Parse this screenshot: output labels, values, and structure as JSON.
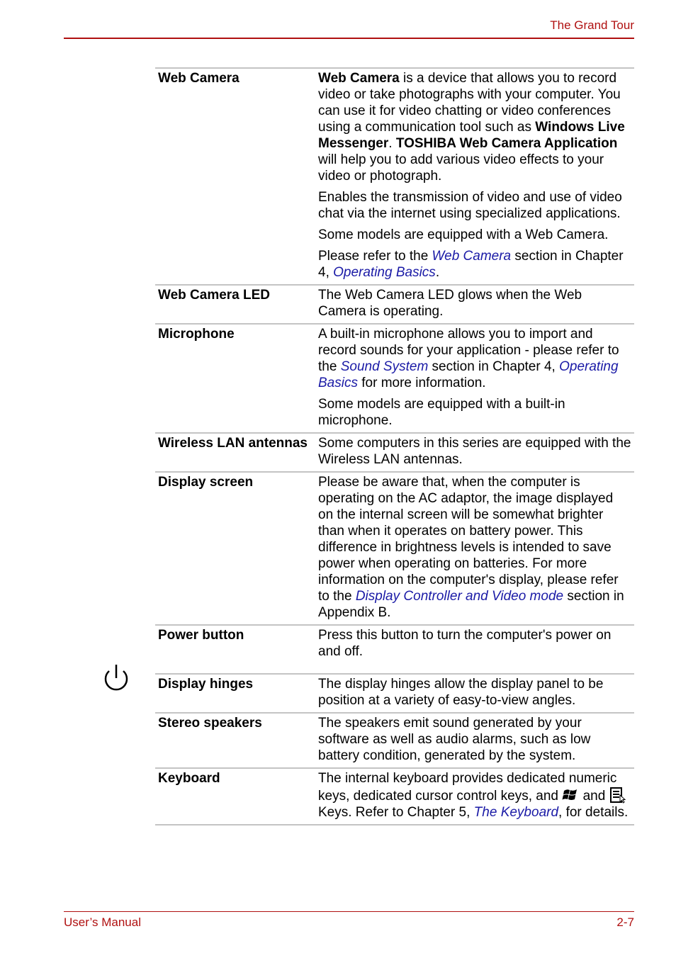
{
  "header": {
    "title": "The Grand Tour",
    "accent_color": "#b01010"
  },
  "footer": {
    "left": "User’s Manual",
    "right": "2-7"
  },
  "link_color": "#1a1aa6",
  "rows": [
    {
      "term": "Web Camera",
      "paragraphs": [
        {
          "segments": [
            {
              "t": "Web Camera",
              "s": "bold"
            },
            {
              "t": " is a device that allows you to record video or take photographs with your computer. You can use it for video chatting or video conferences using a communication tool such as "
            },
            {
              "t": "Windows Live Messenger",
              "s": "bold"
            },
            {
              "t": ". "
            },
            {
              "t": "TOSHIBA Web Camera Application",
              "s": "bold"
            },
            {
              "t": " will help you to add various video effects to your video or photograph."
            }
          ]
        },
        {
          "segments": [
            {
              "t": "Enables the transmission of video and use of video chat via the internet using specialized applications."
            }
          ]
        },
        {
          "segments": [
            {
              "t": "Some models are equipped with a Web Camera."
            }
          ]
        },
        {
          "segments": [
            {
              "t": "Please refer to the "
            },
            {
              "t": "Web Camera",
              "s": "link"
            },
            {
              "t": " section in Chapter 4, "
            },
            {
              "t": "Operating Basics",
              "s": "link"
            },
            {
              "t": "."
            }
          ]
        }
      ]
    },
    {
      "term": "Web Camera LED",
      "paragraphs": [
        {
          "segments": [
            {
              "t": "The Web Camera LED glows when the Web Camera is operating."
            }
          ]
        }
      ]
    },
    {
      "term": "Microphone",
      "paragraphs": [
        {
          "segments": [
            {
              "t": "A built-in microphone allows you to import and record sounds for your application - please refer to the "
            },
            {
              "t": "Sound System",
              "s": "link"
            },
            {
              "t": " section in Chapter 4, "
            },
            {
              "t": "Operating Basics",
              "s": "link"
            },
            {
              "t": " for more information."
            }
          ]
        },
        {
          "segments": [
            {
              "t": "Some models are equipped with a built-in microphone."
            }
          ]
        }
      ]
    },
    {
      "term": "Wireless LAN antennas",
      "paragraphs": [
        {
          "segments": [
            {
              "t": "Some computers in this series are equipped with the Wireless LAN antennas."
            }
          ]
        }
      ]
    },
    {
      "term": "Display screen",
      "paragraphs": [
        {
          "segments": [
            {
              "t": "Please be aware that, when the computer is operating on the AC adaptor, the image displayed on the internal screen will be somewhat brighter than when it operates on battery power. This difference in brightness levels is intended to save power when operating on batteries. For more information on the computer's display, please refer to the "
            },
            {
              "t": "Display Controller and Video mode",
              "s": "link"
            },
            {
              "t": " section in Appendix B."
            }
          ]
        }
      ]
    },
    {
      "term": "Power button",
      "icon": "power-icon",
      "paragraphs": [
        {
          "segments": [
            {
              "t": "Press this button to turn the computer's power on and off."
            }
          ]
        }
      ]
    },
    {
      "term": "Display hinges",
      "paragraphs": [
        {
          "segments": [
            {
              "t": "The display hinges allow the display panel to be position at a variety of easy-to-view angles."
            }
          ]
        }
      ]
    },
    {
      "term": "Stereo speakers",
      "paragraphs": [
        {
          "segments": [
            {
              "t": "The speakers emit sound generated by your software as well as audio alarms, such as low battery condition, generated by the system."
            }
          ]
        }
      ]
    },
    {
      "term": "Keyboard",
      "paragraphs": [
        {
          "segments": [
            {
              "t": "The internal keyboard provides dedicated numeric keys, dedicated cursor control keys, and "
            },
            {
              "icon": "windows-key-icon"
            },
            {
              "t": " and "
            },
            {
              "icon": "application-key-icon"
            },
            {
              "t": " Keys. Refer to Chapter 5, "
            },
            {
              "t": "The Keyboard",
              "s": "link"
            },
            {
              "t": ", for details."
            }
          ]
        }
      ]
    }
  ]
}
